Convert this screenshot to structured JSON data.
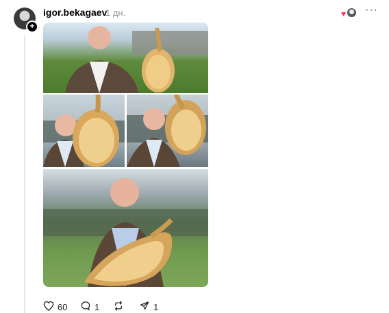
{
  "post": {
    "author": "igor.bekagaev",
    "time": "1 дн.",
    "more_label": "···",
    "likes": "60",
    "replies": "1",
    "shares": "1"
  },
  "icons": {
    "like": "heart-outline-icon",
    "reply": "comment-bubble-icon",
    "repost": "repost-arrows-icon",
    "share": "send-icon"
  },
  "colors": {
    "accent_heart": "#ff2d55",
    "text": "#000000",
    "muted": "#999999"
  }
}
